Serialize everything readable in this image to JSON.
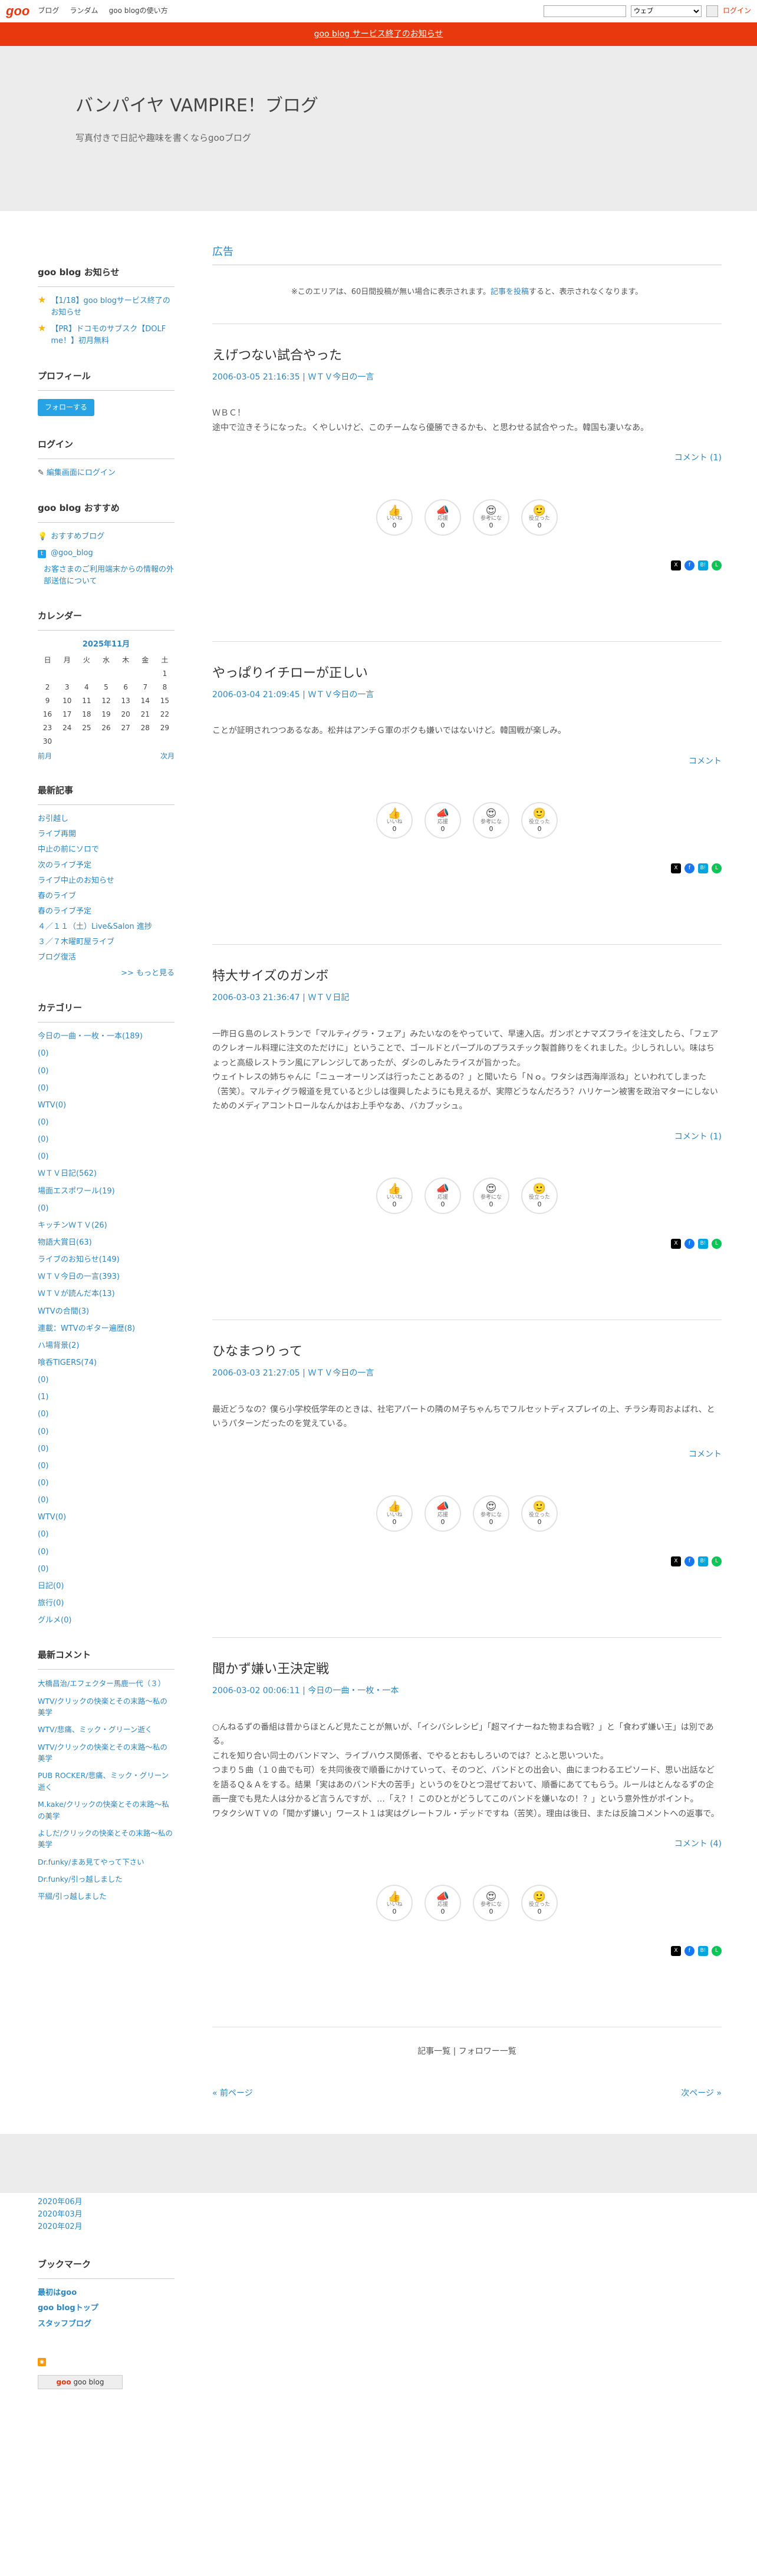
{
  "topbar": {
    "logo": "goo",
    "links": [
      "ブログ",
      "ランダム",
      "goo blogの使い方"
    ],
    "search_option": "ウェブ",
    "login": "ログイン"
  },
  "notice": "goo blog サービス終了のお知らせ",
  "header": {
    "title": "バンパイヤ VAMPIRE！ブログ",
    "subtitle": "写真付きで日記や趣味を書くならgooブログ"
  },
  "sidebar": {
    "news": {
      "title": "goo blog お知らせ",
      "items": [
        "【1/18】goo blogサービス終了のお知らせ",
        "【PR】ドコモのサブスク【DOLF me！】初月無料"
      ]
    },
    "profile": {
      "title": "プロフィール",
      "follow": "フォローする"
    },
    "login": {
      "title": "ログイン",
      "link": "編集画面にログイン"
    },
    "recommend": {
      "title": "goo blog おすすめ",
      "items": [
        "おすすめブログ",
        "@goo_blog",
        "お客さまのご利用端末からの情報の外部送信について"
      ]
    },
    "calendar": {
      "title": "カレンダー",
      "month": "2025年11月",
      "weekdays": [
        "日",
        "月",
        "火",
        "水",
        "木",
        "金",
        "土"
      ],
      "rows": [
        [
          "",
          "",
          "",
          "",
          "",
          "",
          "1"
        ],
        [
          "2",
          "3",
          "4",
          "5",
          "6",
          "7",
          "8"
        ],
        [
          "9",
          "10",
          "11",
          "12",
          "13",
          "14",
          "15"
        ],
        [
          "16",
          "17",
          "18",
          "19",
          "20",
          "21",
          "22"
        ],
        [
          "23",
          "24",
          "25",
          "26",
          "27",
          "28",
          "29"
        ],
        [
          "30",
          "",
          "",
          "",
          "",
          "",
          ""
        ]
      ],
      "prev": "前月",
      "next": "次月"
    },
    "recent": {
      "title": "最新記事",
      "items": [
        "お引越し",
        "ライブ再開",
        "中止の前にソロで",
        "次のライブ予定",
        "ライブ中止のお知らせ",
        "春のライブ",
        "春のライブ予定",
        "４／１１（土）Live&Salon 進捗",
        "３／７木曜町屋ライブ",
        "ブログ復活"
      ],
      "more": ">> もっと見る"
    },
    "categories": {
      "title": "カテゴリー",
      "items": [
        "今日の一曲・一枚・一本(189)",
        "(0)",
        "(0)",
        "(0)",
        "WTV(0)",
        "(0)",
        "(0)",
        "(0)",
        "ＷＴＶ日記(562)",
        "場面エスポワール(19)",
        "(0)",
        "キッチンＷＴＶ(26)",
        "物語大賞日(63)",
        "ライブのお知らせ(149)",
        "ＷＴＶ今日の一言(393)",
        "ＷＴＶが読んだ本(13)",
        "WTVの合間(3)",
        "連載：WTVのギター遍歴(8)",
        "ハ場背景(2)",
        "喰呑TIGERS(74)",
        "(0)",
        "(1)",
        "(0)",
        "(0)",
        "(0)",
        "(0)",
        "(0)",
        "(0)",
        "WTV(0)",
        "(0)",
        "(0)",
        "(0)",
        "日記(0)",
        "旅行(0)",
        "グルメ(0)"
      ]
    },
    "comments": {
      "title": "最新コメント",
      "items": [
        "大橋昌治/エフェクター馬鹿一代（３）",
        "WTV/クリックの快楽とその末路～私の美学",
        "WTV/悲痛、ミック・グリーン逝く",
        "WTV/クリックの快楽とその末路～私の美学",
        "PUB ROCKER/悲痛、ミック・グリーン逝く",
        "M.kake/クリックの快楽とその末路～私の美学",
        "よしだ/クリックの快楽とその末路～私の美学",
        "Dr.funky/まあ見てやって下さい",
        "Dr.funky/引っ越しました",
        "平綴/引っ越しました"
      ]
    }
  },
  "main": {
    "ad_title": "広告",
    "ad_note_pre": "※このエリアは、60日間投稿が無い場合に表示されます。",
    "ad_note_link": "記事を投稿",
    "ad_note_post": "すると、表示されなくなります。",
    "reaction_labels": [
      "いいね",
      "応援",
      "参考にな",
      "役立った"
    ],
    "entries": [
      {
        "title": "えげつない試合やった",
        "date": "2006-03-05 21:16:35",
        "category": "ＷＴＶ今日の一言",
        "body": [
          "ＷＢＣ！",
          "途中で泣きそうになった。くやしいけど、このチームなら優勝できるかも、と思わせる試合やった。韓国も凄いなあ。"
        ],
        "comment": "コメント (1)",
        "counts": [
          "0",
          "0",
          "0",
          "0"
        ]
      },
      {
        "title": "やっぱりイチローが正しい",
        "date": "2006-03-04 21:09:45",
        "category": "ＷＴＶ今日の一言",
        "body": [
          "ことが証明されつつあるなあ。松井はアンチＧ軍のボクも嫌いではないけど。韓国戦が楽しみ。"
        ],
        "comment": "コメント",
        "counts": [
          "0",
          "0",
          "0",
          "0"
        ]
      },
      {
        "title": "特大サイズのガンボ",
        "date": "2006-03-03 21:36:47",
        "category": "ＷＴＶ日記",
        "body": [
          "一昨日Ｇ島のレストランで「マルティグラ・フェア」みたいなのをやっていて、早速入店。ガンボとナマズフライを注文したら、「フェアのクレオール料理に注文のただけに」ということで、ゴールドとパープルのプラスチック製首飾りをくれました。少しうれしい。味はちょっと高級レストラン風にアレンジしてあったが、ダシのしみたライスが旨かった。",
          "ウェイトレスの姉ちゃんに「ニューオーリンズは行ったことあるの？」と聞いたら「Ｎｏ。ワタシは西海岸派ね」といわれてしまった（苦笑）。マルティグラ報道を見ていると少しは復興したようにも見えるが、実際どうなんだろう？ハリケーン被害を政治マターにしないためのメディアコントロールなんかはお上手やなあ、バカブッシュ。"
        ],
        "comment": "コメント (1)",
        "counts": [
          "0",
          "0",
          "0",
          "0"
        ]
      },
      {
        "title": "ひなまつりって",
        "date": "2006-03-03 21:27:05",
        "category": "ＷＴＶ今日の一言",
        "body": [
          "最近どうなの？僕ら小学校低学年のときは、社宅アパートの隣のＭ子ちゃんちでフルセットディスプレイの上、チラシ寿司およばれ、というパターンだったのを覚えている。"
        ],
        "comment": "コメント",
        "counts": [
          "0",
          "0",
          "0",
          "0"
        ]
      },
      {
        "title": "聞かず嫌い王決定戦",
        "date": "2006-03-02 00:06:11",
        "category": "今日の一曲・一枚・一本",
        "body": [
          "○んねるずの番組は昔からほとんど見たことが無いが、「イシバシレシピ」「超マイナーねた物まね合戦？」と「食わず嫌い王」は別である。",
          "これを知り合い同士のバンドマン、ライブハウス関係者、でやるとおもしろいのでは？とふと思いついた。",
          "つまり５曲（１０曲でも可）を共同後夜で順番にかけていって、そのつど、バンドとの出会い、曲にまつわるエピソード、思い出話などを語るＱ＆Ａをする。結果「実はあのバンド大の苦手」というのをひとつ混ぜておいて、順番にあててもらう。ルールはとんなるずの企画一度でも見た人は分かるど言うんですが、…「え？！このひとがどうしてこのバンドを嫌いなの！？」という意外性がポイント。",
          "ワタクシＷＴＶの「聞かず嫌い」ワースト１は実はグレートフル・デッドですね（苦笑）。理由は後日、または反論コメントへの返事で。"
        ],
        "comment": "コメント (4)",
        "counts": [
          "0",
          "0",
          "0",
          "0"
        ]
      }
    ],
    "list_links": "記事一覧 | フォロワー一覧",
    "prev_page": "« 前ページ",
    "next_page": "次ページ »"
  },
  "footer": {
    "archives": [
      "2020年06月",
      "2020年03月",
      "2020年02月"
    ],
    "bookmark": {
      "title": "ブックマーク",
      "items": [
        "最初はgoo",
        "goo blogトップ",
        "スタッフブログ"
      ]
    },
    "badge": "goo blog"
  }
}
